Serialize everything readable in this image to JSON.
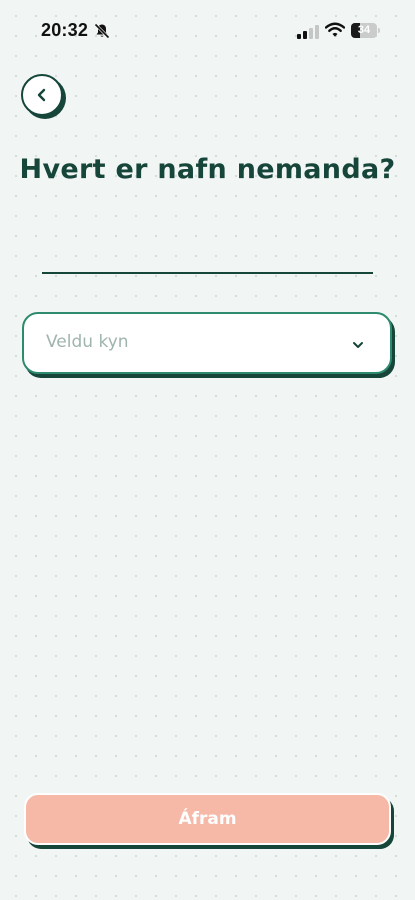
{
  "status_bar": {
    "time": "20:32",
    "battery_percent": "34",
    "battery_level": 0.34,
    "icons": [
      "bell-slash-icon",
      "cellular-signal-icon",
      "wifi-icon",
      "battery-icon"
    ]
  },
  "header": {
    "back_icon": "chevron-left-icon"
  },
  "main": {
    "title": "Hvert er nafn nemanda?",
    "name_input": {
      "value": "",
      "placeholder": ""
    },
    "gender_select": {
      "placeholder": "Veldu kyn",
      "icon": "chevron-down-icon"
    }
  },
  "footer": {
    "continue_label": "Áfram"
  },
  "colors": {
    "primary_dark": "#16453a",
    "accent_green": "#2d8a6e",
    "button_disabled": "#f6b8a7",
    "placeholder": "#9fb4ae",
    "background": "#f1f5f3"
  }
}
